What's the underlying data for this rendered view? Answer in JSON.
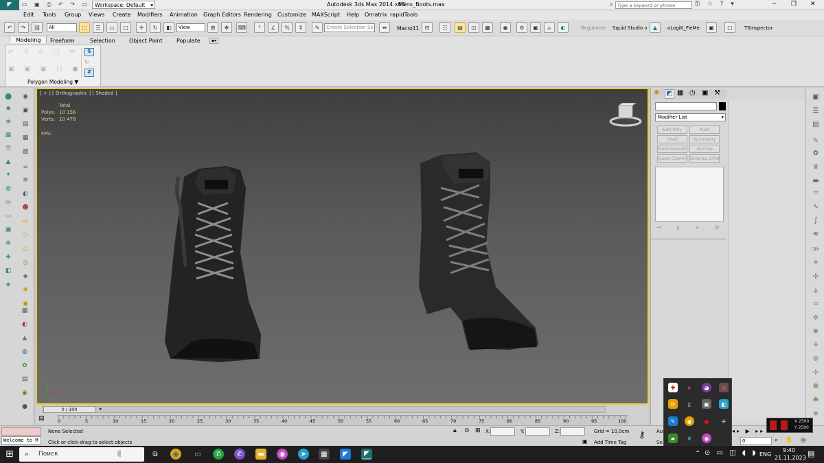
{
  "title_bar": {
    "workspace": "Workspace: Default",
    "app_title": "Autodesk 3ds Max  2014 x64",
    "file_name": "Mens_Boots.max",
    "search_placeholder": "Type a keyword or phrase"
  },
  "menu": [
    "Edit",
    "Tools",
    "Group",
    "Views",
    "Create",
    "Modifiers",
    "Animation",
    "Graph Editors",
    "Rendering",
    "Customize",
    "MAXScript",
    "Help",
    "Ornatrix",
    "rapidTools"
  ],
  "main_toolbar": {
    "filter_value": "All",
    "view_value": "View",
    "selection_set_placeholder": "Create Selection Se",
    "macro_label": "Macro11",
    "regularize": "Regularize",
    "squid": "Squid Studio v",
    "flowlogik": "oLogiK_FieMe",
    "tsinspector": "TSInspector"
  },
  "ribbon": {
    "tabs": [
      "Modeling",
      "Freeform",
      "Selection",
      "Object Paint",
      "Populate"
    ],
    "active_tab": "Modeling",
    "panel_label": "Polygon Modeling ▼"
  },
  "viewport": {
    "label": "[ + ] [ Orthographic ] [ Shaded ]",
    "stats_header": "Total",
    "polys_label": "Polys:",
    "polys_value": "10 156",
    "verts_label": "Verts:",
    "verts_value": "10 478",
    "fps_label": "FPS:"
  },
  "command_panel": {
    "modifier_list": "Modifier List",
    "buttons": [
      "Edit Poly",
      "Push",
      "Shell",
      "Symmetry",
      "TurboSmooth",
      "Normal",
      "Quad Chamfer",
      "Unwrap UVW"
    ]
  },
  "timeline": {
    "frame_counter": "0 / 100",
    "ticks": [
      "0",
      "5",
      "10",
      "15",
      "20",
      "25",
      "30",
      "35",
      "40",
      "45",
      "50",
      "55",
      "60",
      "65",
      "70",
      "75",
      "80",
      "85",
      "90",
      "95",
      "100"
    ]
  },
  "status": {
    "welcome": "Welcome to M",
    "none_selected": "None Selected",
    "prompt": "Click or click-drag to select objects",
    "x_label": "X:",
    "y_label": "Y:",
    "z_label": "Z:",
    "grid": "Grid = 10,0cm",
    "add_time_tag": "Add Time Tag",
    "auto": "Auto",
    "set": "Se",
    "frame_value": "0",
    "coord_x": "X 2500",
    "coord_y": "Y 2500"
  },
  "taskbar": {
    "search": "Поиск",
    "lang": "ENG",
    "time": "9:40",
    "date": "21.11.2023"
  }
}
